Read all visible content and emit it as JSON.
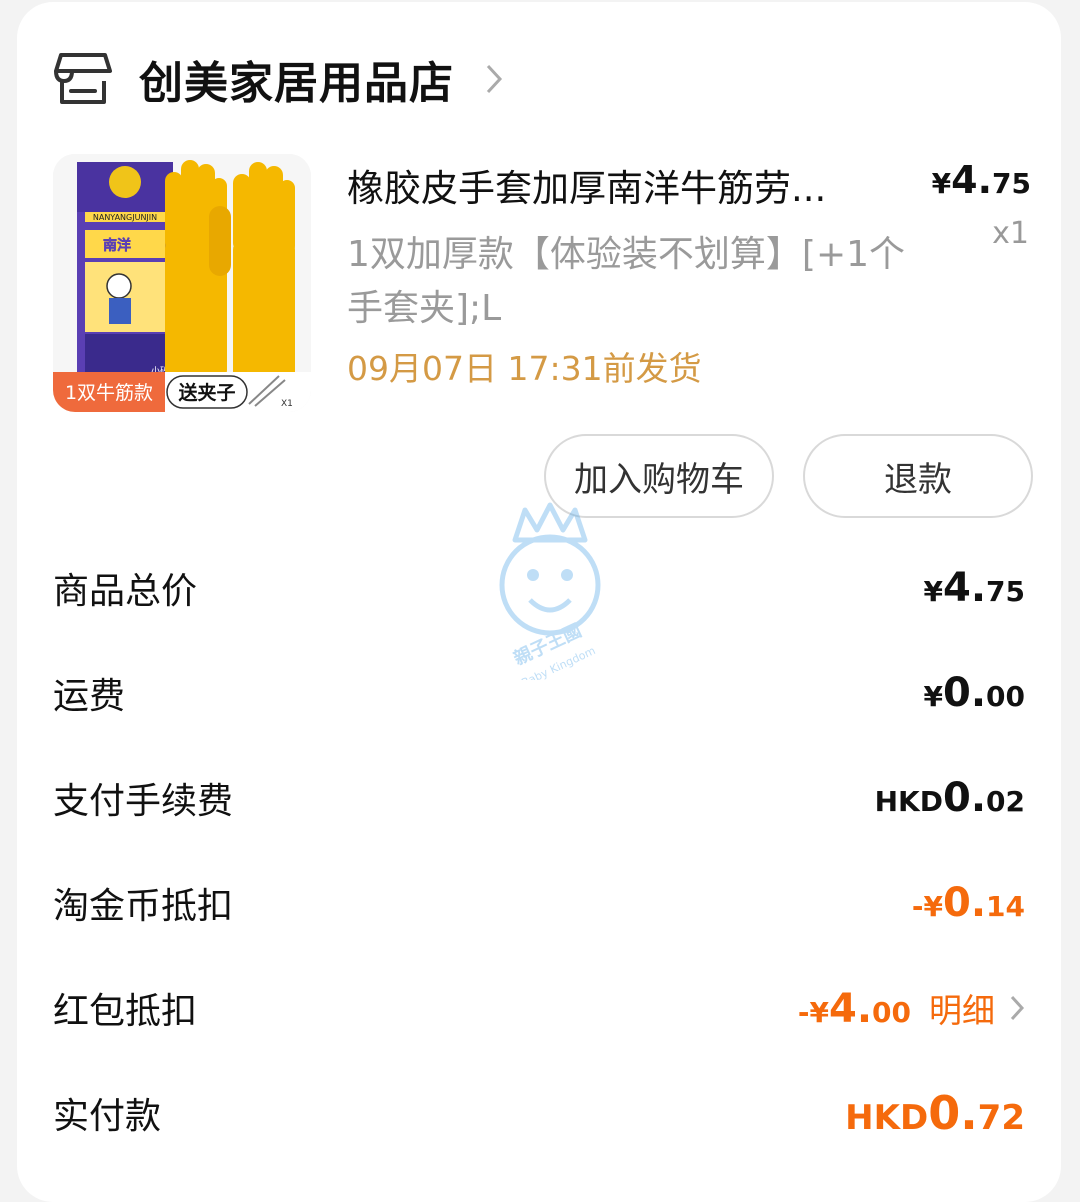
{
  "shop": {
    "name": "创美家居用品店"
  },
  "product": {
    "title": "橡胶皮手套加厚南洋牛筋劳...",
    "price": {
      "currency": "¥",
      "int": "4.",
      "dec": "75"
    },
    "quantity": "x1",
    "sku": "1双加厚款【体验装不划算】[+1个手套夹];L",
    "ship_time": "09月07日 17:31前发货",
    "image_texts": {
      "brand": "NANYANGJUNJIN",
      "pack_name": "南洋",
      "size": "小码",
      "badge_left": "1双牛筋款",
      "badge_right": "送夹子",
      "badge_x": "X1"
    }
  },
  "buttons": {
    "add_to_cart": "加入购物车",
    "refund": "退款"
  },
  "watermark": {
    "text_cn": "親子王國",
    "text_en": "Baby Kingdom"
  },
  "summary": [
    {
      "label": "商品总价",
      "cur": "¥",
      "int": "4.",
      "dec": "75"
    },
    {
      "label": "运费",
      "cur": "¥",
      "int": "0.",
      "dec": "00"
    },
    {
      "label": "支付手续费",
      "cur": "HKD ",
      "int": "0.",
      "dec": "02"
    },
    {
      "label": "淘金币抵扣",
      "cur": "-¥",
      "int": "0.",
      "dec": "14"
    },
    {
      "label": "红包抵扣",
      "cur": "-¥",
      "int": "4.",
      "dec": "00",
      "detail": "明细"
    },
    {
      "label": "实付款",
      "cur": "HKD ",
      "int": "0.",
      "dec": "72"
    }
  ],
  "colors": {
    "accent": "#f56a0c",
    "ship": "#d49a45",
    "muted": "#9a9a9a"
  }
}
